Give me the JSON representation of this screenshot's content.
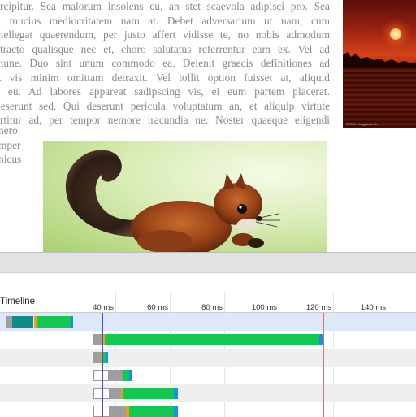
{
  "article": {
    "lines": [
      "ercipitur. Sea malorum insolens cu, an stet scaevola adipisci pro. Sea",
      "ı, mucius mediocritatem nam at. Debet adversarium ut nam, cum",
      "ntellegat quaerendum, per justo affert vidisse te, no nobis admodum",
      "etracto qualisque nec et, choro salutatus referrentur eam ex. Vel ad",
      "mune. Duo sint unum commodo ea. Delenit graecis definitiones ad",
      "it vis minim omittam detraxit. Vel tollit option fuisset at, aliquid",
      "e eu. Ad labores appareat sadipscing vis, ei eum partem placerat.",
      "deserunt sed. Qui deserunt pericula voluptatum an, et aliquip virtute",
      "ertitur ad, per tempor nemore iracundia ne. Noster quaeque eligendi"
    ],
    "fragments": [
      "nero",
      "mper",
      "nicus"
    ],
    "sunset_caption": "©2008 Hongjiabao Hm"
  },
  "timeline": {
    "title": "Timeline",
    "ticks": [
      "40 ms",
      "60 ms",
      "80 ms",
      "100 ms",
      "120 ms",
      "140 ms"
    ],
    "tick_values_ms": [
      40,
      60,
      80,
      100,
      120,
      140
    ],
    "markers": [
      {
        "name": "dom-content-loaded",
        "at_ms": 35,
        "color": "#4a4fd8"
      },
      {
        "name": "load-event",
        "at_ms": 116,
        "color": "#e07070"
      }
    ],
    "rows": [
      {
        "selected": true,
        "segments": [
          [
            "gray",
            0,
            2
          ],
          [
            "teal",
            2,
            10
          ],
          [
            "orange",
            10,
            11
          ],
          [
            "green",
            11,
            24
          ],
          [
            "blue",
            24,
            24.5
          ]
        ]
      },
      {
        "selected": false,
        "segments": [
          [
            "gray",
            32,
            35
          ],
          [
            "orange",
            35,
            36
          ],
          [
            "green",
            36,
            115
          ],
          [
            "blue",
            115,
            116.2
          ]
        ]
      },
      {
        "selected": false,
        "segments": [
          [
            "gray",
            32,
            34.5
          ],
          [
            "orange",
            34.5,
            35
          ],
          [
            "green",
            35,
            36.8
          ],
          [
            "blue",
            36.8,
            37.2
          ]
        ]
      },
      {
        "selected": false,
        "segments": [
          [
            "queued",
            32,
            37.5
          ],
          [
            "gray",
            37.5,
            43
          ],
          [
            "green",
            43,
            45
          ],
          [
            "blue",
            45,
            46.2
          ]
        ]
      },
      {
        "selected": false,
        "segments": [
          [
            "queued",
            32,
            37.8
          ],
          [
            "gray",
            37.8,
            42
          ],
          [
            "orange",
            42,
            43
          ],
          [
            "green",
            43,
            61.5
          ],
          [
            "blue",
            61.5,
            63
          ]
        ]
      },
      {
        "selected": false,
        "segments": [
          [
            "queued",
            32,
            38
          ],
          [
            "gray",
            38,
            44
          ],
          [
            "orange",
            44,
            45
          ],
          [
            "green",
            45,
            61.5
          ],
          [
            "blue",
            61.5,
            63
          ]
        ]
      }
    ],
    "colors": {
      "selected_row": "#dde9f8",
      "alt_row": "#efefef",
      "green": "#16c653",
      "teal": "#128a8a",
      "orange": "#f59a1a",
      "blue": "#1a8fea"
    }
  }
}
